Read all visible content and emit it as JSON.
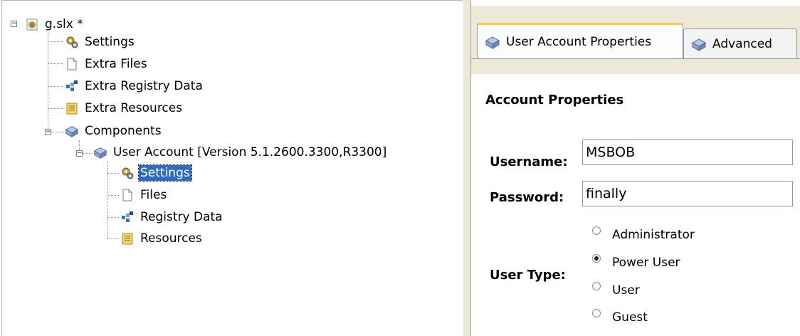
{
  "tree": {
    "root": {
      "label": "g.slx *",
      "expander": "−"
    },
    "root_children": [
      {
        "label": "Settings",
        "icon": "gears-icon"
      },
      {
        "label": "Extra Files",
        "icon": "file-icon"
      },
      {
        "label": "Extra Registry Data",
        "icon": "registry-icon"
      },
      {
        "label": "Extra Resources",
        "icon": "resources-icon"
      }
    ],
    "components": {
      "label": "Components",
      "expander": "−"
    },
    "user_account": {
      "label": "User Account [Version 5.1.2600.3300,R3300]",
      "expander": "−"
    },
    "ua_children": [
      {
        "label": "Settings",
        "icon": "gears-icon",
        "selected": true
      },
      {
        "label": "Files",
        "icon": "file-icon"
      },
      {
        "label": "Registry Data",
        "icon": "registry-icon"
      },
      {
        "label": "Resources",
        "icon": "resources-icon"
      }
    ]
  },
  "tabs": {
    "active_label": "User Account Properties",
    "second_label": "Advanced"
  },
  "form": {
    "heading": "Account Properties",
    "username_label": "Username:",
    "username_value": "MSBOB",
    "password_label": "Password:",
    "password_value": "finally",
    "user_type_label": "User Type:",
    "options": [
      "Administrator",
      "Power User",
      "User",
      "Guest"
    ],
    "selected_option": "Power User"
  },
  "colors": {
    "selection": "#316ac5",
    "tab_accent": "#ffc83c"
  }
}
